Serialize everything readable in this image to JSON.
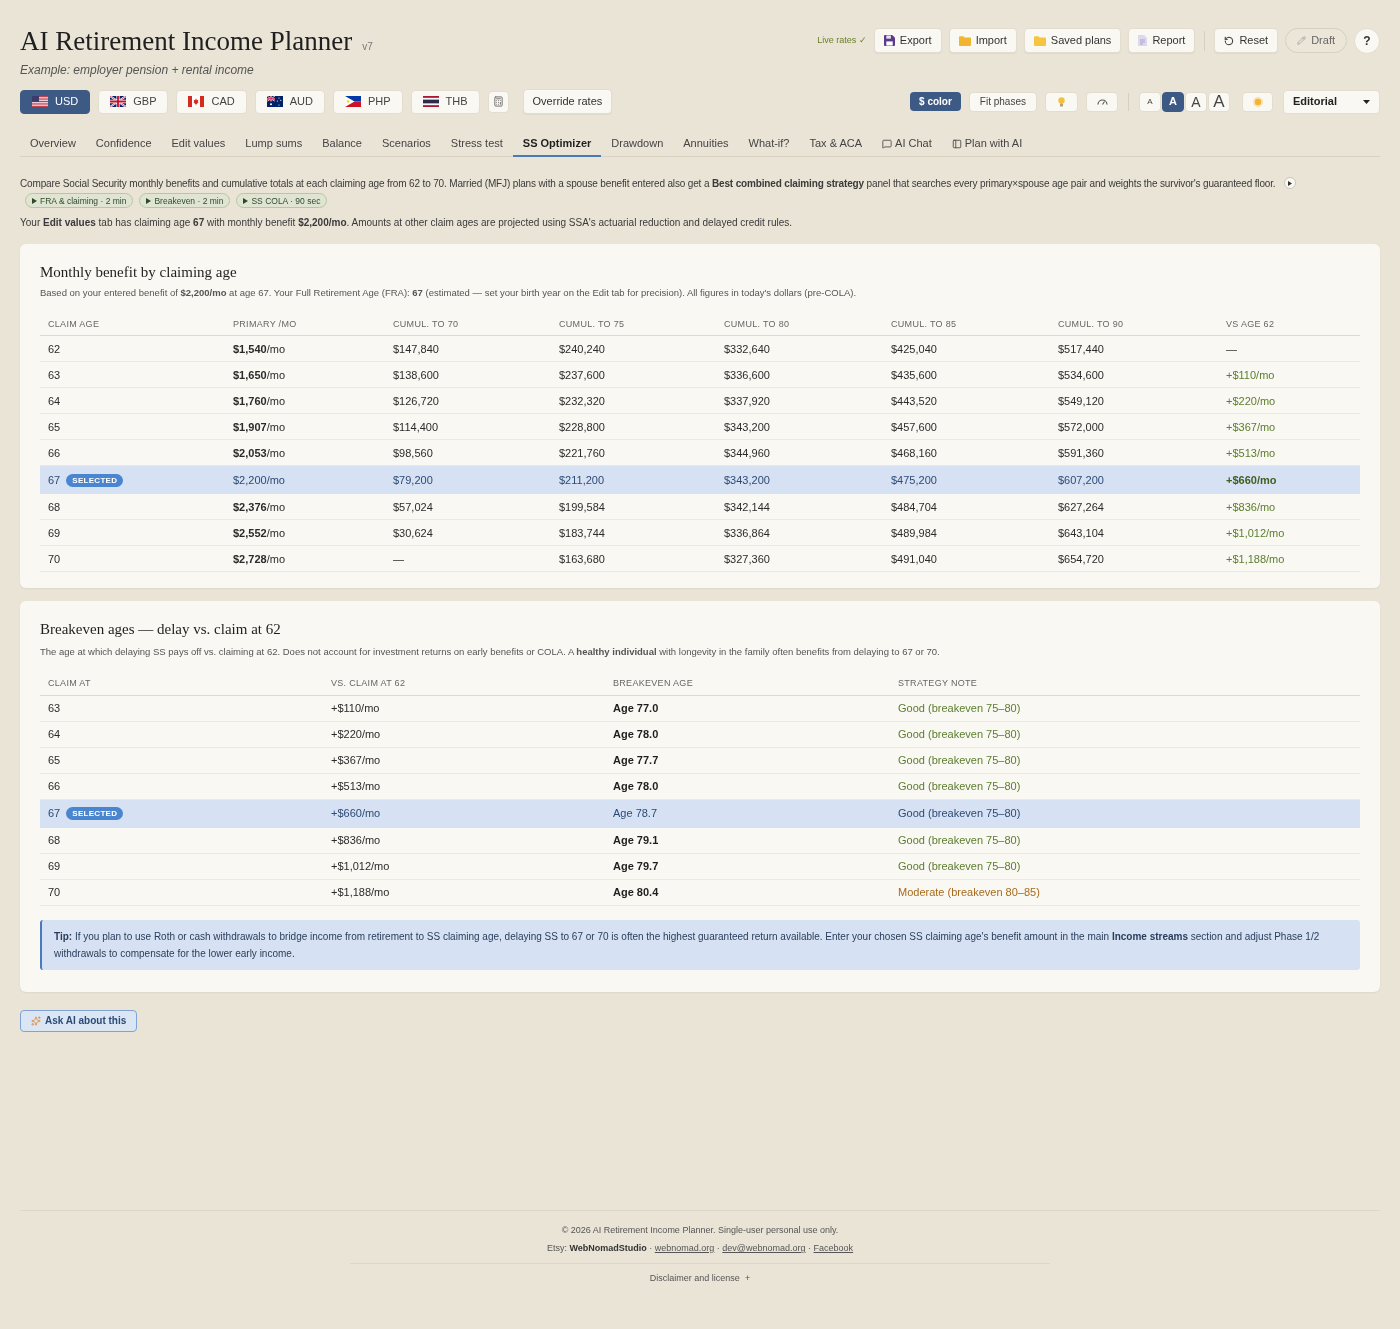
{
  "header": {
    "title": "AI Retirement Income Planner",
    "version": "v7",
    "subtitle": "Example: employer pension + rental income",
    "live_rates": "Live rates ✓",
    "actions": [
      {
        "kind": "export",
        "label": "Export"
      },
      {
        "kind": "import",
        "label": "Import"
      },
      {
        "kind": "saved",
        "label": "Saved plans"
      },
      {
        "kind": "report",
        "label": "Report"
      },
      {
        "kind": "reset",
        "label": "Reset"
      },
      {
        "kind": "draft",
        "label": "Draft"
      }
    ],
    "help": "?"
  },
  "currencies": [
    {
      "code": "USD",
      "kind": "us",
      "selected": true
    },
    {
      "code": "GBP",
      "kind": "uk",
      "selected": false
    },
    {
      "code": "CAD",
      "kind": "ca",
      "selected": false
    },
    {
      "code": "AUD",
      "kind": "au",
      "selected": false
    },
    {
      "code": "PHP",
      "kind": "ph",
      "selected": false
    },
    {
      "code": "THB",
      "kind": "th",
      "selected": false
    }
  ],
  "override_rates": "Override rates",
  "toolbar": {
    "color_toggle": {
      "label": "$ color",
      "on": true
    },
    "fit_phases": "Fit phases",
    "text_sizes": [
      {
        "label": "A",
        "selected": false
      },
      {
        "label": "A",
        "selected": true
      },
      {
        "label": "A",
        "selected": false
      },
      {
        "label": "A",
        "selected": false
      }
    ],
    "theme": "Editorial"
  },
  "tabs": [
    {
      "label": "Overview",
      "kind": "plain",
      "selected": false
    },
    {
      "label": "Confidence",
      "kind": "plain",
      "selected": false
    },
    {
      "label": "Edit values",
      "kind": "plain",
      "selected": false
    },
    {
      "label": "Lump sums",
      "kind": "plain",
      "selected": false
    },
    {
      "label": "Balance",
      "kind": "plain",
      "selected": false
    },
    {
      "label": "Scenarios",
      "kind": "plain",
      "selected": false
    },
    {
      "label": "Stress test",
      "kind": "plain",
      "selected": false
    },
    {
      "label": "SS Optimizer",
      "kind": "plain",
      "selected": true
    },
    {
      "label": "Drawdown",
      "kind": "plain",
      "selected": false
    },
    {
      "label": "Annuities",
      "kind": "plain",
      "selected": false
    },
    {
      "label": "What-if?",
      "kind": "plain",
      "selected": false
    },
    {
      "label": "Tax & ACA",
      "kind": "plain",
      "selected": false
    },
    {
      "label": "AI Chat",
      "kind": "chat",
      "selected": false
    },
    {
      "label": "Plan with AI",
      "kind": "panel",
      "selected": false
    }
  ],
  "intro": {
    "text": "Compare Social Security monthly benefits and cumulative totals at each claiming age from 62 to 70. Married (MFJ) plans with a spouse benefit entered also get a **Best combined claiming strategy** panel that searches every primary×spouse age pair and weights the survivor's guaranteed floor.",
    "videos": [
      "FRA & claiming · 2 min",
      "Breakeven · 2 min",
      "SS COLA · 90 sec"
    ],
    "note": "Your **Edit values** tab has claiming age **67** with monthly benefit **$2,200/mo**. Amounts at other claim ages are projected using SSA's actuarial reduction and delayed credit rules."
  },
  "benefit_table": {
    "title": "Monthly benefit by claiming age",
    "subtitle": "Based on your entered benefit of **$2,200/mo** at age 67. Your Full Retirement Age (FRA): **67** (estimated — set your birth year on the Edit tab for precision). All figures in today's dollars (pre-COLA).",
    "columns": [
      "CLAIM AGE",
      "PRIMARY /MO",
      "CUMUL. TO 70",
      "CUMUL. TO 75",
      "CUMUL. TO 80",
      "CUMUL. TO 85",
      "CUMUL. TO 90",
      "VS AGE 62"
    ],
    "rows": [
      {
        "age": "62",
        "primary": "**$1,540**/mo",
        "cumulative": [
          "$147,840",
          "$240,240",
          "$332,640",
          "$425,040",
          "$517,440"
        ],
        "vs_62": "—",
        "gain": false,
        "selected": false
      },
      {
        "age": "63",
        "primary": "**$1,650**/mo",
        "cumulative": [
          "$138,600",
          "$237,600",
          "$336,600",
          "$435,600",
          "$534,600"
        ],
        "vs_62": "+$110/mo",
        "gain": true,
        "selected": false
      },
      {
        "age": "64",
        "primary": "**$1,760**/mo",
        "cumulative": [
          "$126,720",
          "$232,320",
          "$337,920",
          "$443,520",
          "$549,120"
        ],
        "vs_62": "+$220/mo",
        "gain": true,
        "selected": false
      },
      {
        "age": "65",
        "primary": "**$1,907**/mo",
        "cumulative": [
          "$114,400",
          "$228,800",
          "$343,200",
          "$457,600",
          "$572,000"
        ],
        "vs_62": "+$367/mo",
        "gain": true,
        "selected": false
      },
      {
        "age": "66",
        "primary": "**$2,053**/mo",
        "cumulative": [
          "$98,560",
          "$221,760",
          "$344,960",
          "$468,160",
          "$591,360"
        ],
        "vs_62": "+$513/mo",
        "gain": true,
        "selected": false
      },
      {
        "age": "67",
        "badge": "SELECTED",
        "primary": "$2,200/mo",
        "cumulative": [
          "$79,200",
          "$211,200",
          "$343,200",
          "$475,200",
          "$607,200"
        ],
        "vs_62": "+$660/mo",
        "gain": true,
        "selected": true
      },
      {
        "age": "68",
        "primary": "**$2,376**/mo",
        "cumulative": [
          "$57,024",
          "$199,584",
          "$342,144",
          "$484,704",
          "$627,264"
        ],
        "vs_62": "+$836/mo",
        "gain": true,
        "selected": false
      },
      {
        "age": "69",
        "primary": "**$2,552**/mo",
        "cumulative": [
          "$30,624",
          "$183,744",
          "$336,864",
          "$489,984",
          "$643,104"
        ],
        "vs_62": "+$1,012/mo",
        "gain": true,
        "selected": false
      },
      {
        "age": "70",
        "primary": "**$2,728**/mo",
        "cumulative": [
          "—",
          "$163,680",
          "$327,360",
          "$491,040",
          "$654,720"
        ],
        "vs_62": "+$1,188/mo",
        "gain": true,
        "selected": false
      }
    ]
  },
  "breakeven_table": {
    "title": "Breakeven ages — delay vs. claim at 62",
    "subtitle": "The age at which delaying SS pays off vs. claiming at 62. Does not account for investment returns on early benefits or COLA. A **healthy individual** with longevity in the family often benefits from delaying to 67 or 70.",
    "columns": [
      "CLAIM AT",
      "VS. CLAIM AT 62",
      "BREAKEVEN AGE",
      "STRATEGY NOTE"
    ],
    "rows": [
      {
        "claim_at": "63",
        "delta": "+$110/mo",
        "breakeven": "Age 77.0",
        "note": "Good (breakeven 75–80)",
        "kind": "good",
        "selected": false
      },
      {
        "claim_at": "64",
        "delta": "+$220/mo",
        "breakeven": "Age 78.0",
        "note": "Good (breakeven 75–80)",
        "kind": "good",
        "selected": false
      },
      {
        "claim_at": "65",
        "delta": "+$367/mo",
        "breakeven": "Age 77.7",
        "note": "Good (breakeven 75–80)",
        "kind": "good",
        "selected": false
      },
      {
        "claim_at": "66",
        "delta": "+$513/mo",
        "breakeven": "Age 78.0",
        "note": "Good (breakeven 75–80)",
        "kind": "good",
        "selected": false
      },
      {
        "claim_at": "67",
        "badge": "SELECTED",
        "delta": "+$660/mo",
        "breakeven": "Age 78.7",
        "note": "Good (breakeven 75–80)",
        "kind": "good",
        "selected": true
      },
      {
        "claim_at": "68",
        "delta": "+$836/mo",
        "breakeven": "Age 79.1",
        "note": "Good (breakeven 75–80)",
        "kind": "good",
        "selected": false
      },
      {
        "claim_at": "69",
        "delta": "+$1,012/mo",
        "breakeven": "Age 79.7",
        "note": "Good (breakeven 75–80)",
        "kind": "good",
        "selected": false
      },
      {
        "claim_at": "70",
        "delta": "+$1,188/mo",
        "breakeven": "Age 80.4",
        "note": "Moderate (breakeven 80–85)",
        "kind": "moderate",
        "selected": false
      }
    ],
    "tip": "**Tip:** If you plan to use Roth or cash withdrawals to bridge income from retirement to SS claiming age, delaying SS to 67 or 70 is often the highest guaranteed return available. Enter your chosen SS claiming age's benefit amount in the main **Income streams** section and adjust Phase 1/2 withdrawals to compensate for the lower early income."
  },
  "ask_ai": "Ask AI about this",
  "footer": {
    "copyright": "© 2026 AI Retirement Income Planner. Single-user personal use only.",
    "etsy_label": "Etsy:",
    "brand": "WebNomadStudio",
    "separator": "·",
    "links": [
      "webnomad.org",
      "dev@webnomad.org",
      "Facebook"
    ],
    "disclaimer": "Disclaimer and license",
    "disclaimer_toggle": "+"
  }
}
